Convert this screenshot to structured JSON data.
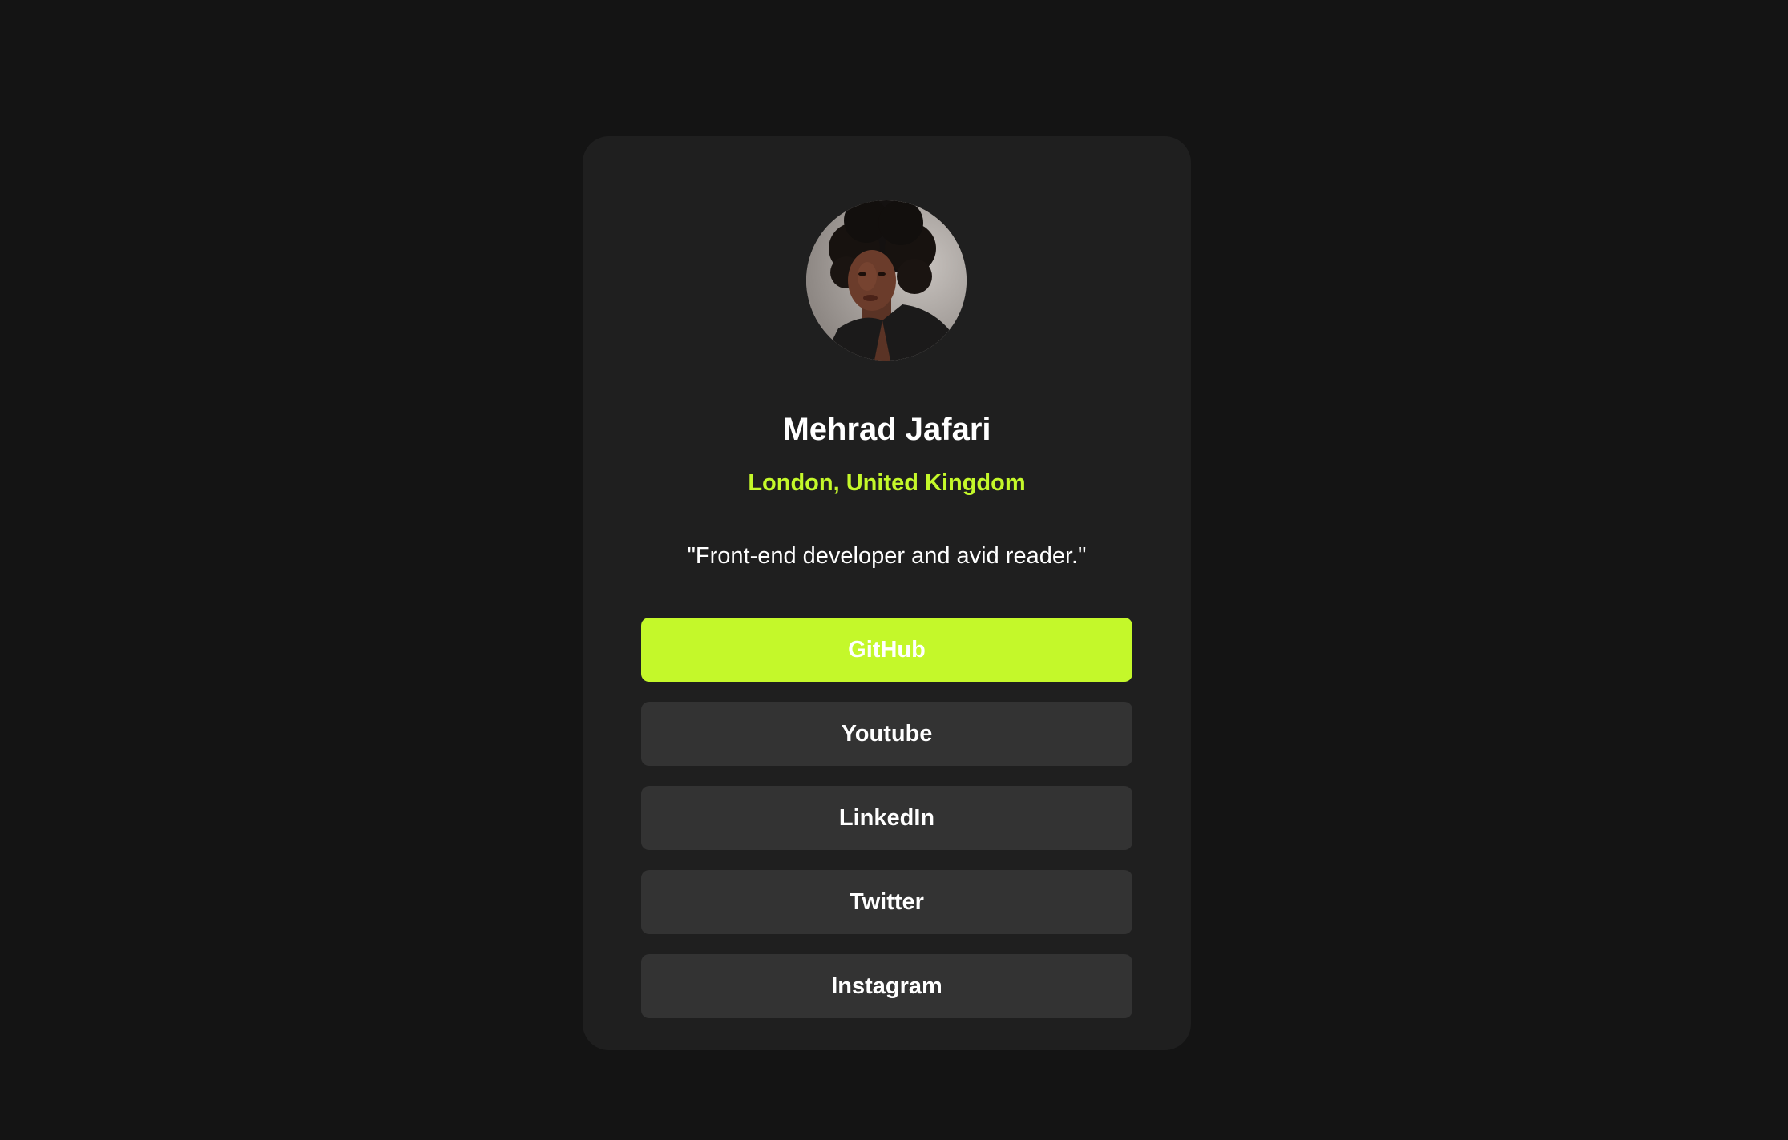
{
  "profile": {
    "name": "Mehrad Jafari",
    "location": "London, United Kingdom",
    "bio": "\"Front-end developer and avid reader.\""
  },
  "links": [
    {
      "label": "GitHub",
      "active": true
    },
    {
      "label": "Youtube",
      "active": false
    },
    {
      "label": "LinkedIn",
      "active": false
    },
    {
      "label": "Twitter",
      "active": false
    },
    {
      "label": "Instagram",
      "active": false
    }
  ],
  "colors": {
    "page_background": "#141414",
    "card_background": "#1f1f1f",
    "accent": "#c4f82a",
    "button_background": "#333333",
    "text": "#ffffff"
  }
}
